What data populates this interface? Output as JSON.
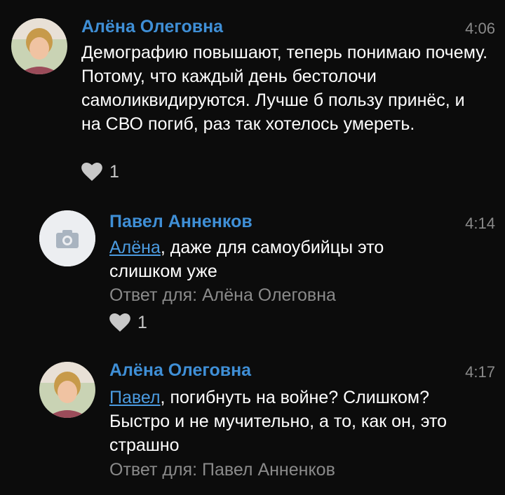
{
  "comments": [
    {
      "author": "Алёна Олеговна",
      "time": "4:06",
      "text": "Демографию повышают, теперь понимаю почему. Потому, что каждый день бестолочи самоликвидируются. Лучше б пользу принёс, и на СВО погиб, раз так хотелось умереть.",
      "likes": "1",
      "avatar": "photo-avatar"
    },
    {
      "author": "Павел Анненков",
      "time": "4:14",
      "mention": "Алёна",
      "text": ", даже для самоубийцы это слишком уже",
      "reply_to": "Ответ для: Алёна Олеговна",
      "likes": "1",
      "avatar": "camera-placeholder-icon"
    },
    {
      "author": "Алёна Олеговна",
      "time": "4:17",
      "mention": "Павел",
      "text": ", погибнуть на войне? Слишком? Быстро и не мучительно, а то, как он, это страшно",
      "reply_to": "Ответ для: Павел Анненков",
      "avatar": "photo-avatar"
    }
  ],
  "colors": {
    "background": "#0c0c0c",
    "author": "#3f8fd6",
    "mention": "#4b9be0",
    "text": "#ffffff",
    "meta": "#8a8a8a"
  }
}
